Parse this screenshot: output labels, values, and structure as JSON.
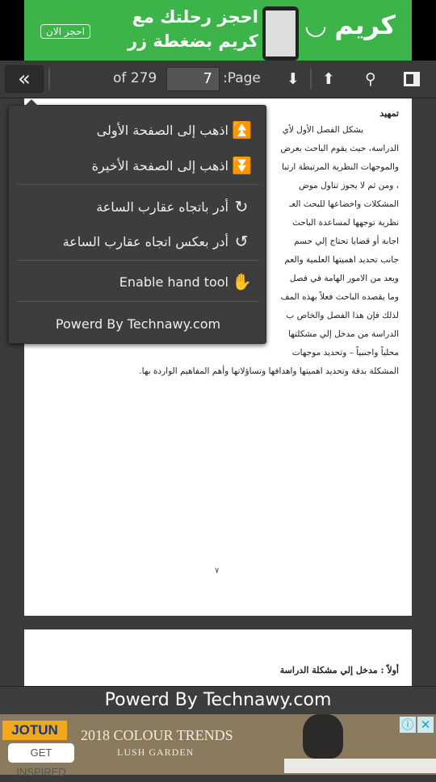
{
  "top_ad": {
    "brand": "كريم",
    "headline": "احجز رحلتك مع كريم بضغطة زر",
    "cta": "احجز الان",
    "brand_color": "#3cb449"
  },
  "toolbar": {
    "sidebar_toggle_icon": "double-chevron-left",
    "page_label": ":Page",
    "page_value": "7",
    "page_total": "of 279",
    "icons": [
      "arrow-down",
      "arrow-up",
      "search",
      "sidebar-panel"
    ]
  },
  "menu": {
    "items": [
      {
        "label": "اذهب إلى الصفحة الأولى",
        "icon": "first-page"
      },
      {
        "label": "اذهب إلى الصفحة الأخيرة",
        "icon": "last-page"
      },
      {
        "label": "أدر باتجاه عقارب الساعة",
        "icon": "rotate-clockwise"
      },
      {
        "label": "أدر بعكس اتجاه عقارب الساعة",
        "icon": "rotate-counterclockwise"
      },
      {
        "label": "Enable hand tool",
        "icon": "hand"
      },
      {
        "label": "Powerd By Technawy.com"
      }
    ]
  },
  "document": {
    "heading": "تمهيد",
    "lines": [
      "يشكل الفصل الأول لأي",
      "الدراسة، حيث يقوم الباحث بعرض",
      "والموجهات النظرية المرتبطة ارتبا",
      "، ومن ثم لا يجوز تناول موض",
      "المشكلات واخضاعها للبحث العـ",
      "نظرية توجهها لمساعدة الباحث",
      "اجابة أو قضايا تحتاج إلي حسم",
      "جانب تحديد اهميتها العلمية والعم",
      "ويعد من الامور الهامة في فصل",
      "وما يقصده الباحث فعلاً بهذه المف",
      "لذلك فإن هذا الفصل والخاص ب",
      "الدراسة من مدخل إلي مشكلتها",
      "محلياً واجنبياً – وتحديد موجهات",
      "المشكلة بدقة وتحديد اهميتها واهدافها وتساؤلاتها وأهم المفاهيم الواردة بها."
    ],
    "page_number": "٧",
    "next_page_heading": "أولاً : مدخل إلي مشكلة الدراسة"
  },
  "footer": {
    "text": "Powerd By Technawy.com"
  },
  "bottom_ad": {
    "brand": "JOTUN",
    "cta": "GET INSPIRED",
    "headline": "2018 COLOUR TRENDS",
    "subline": "LUSH GARDEN",
    "icons": [
      "info",
      "close"
    ]
  }
}
